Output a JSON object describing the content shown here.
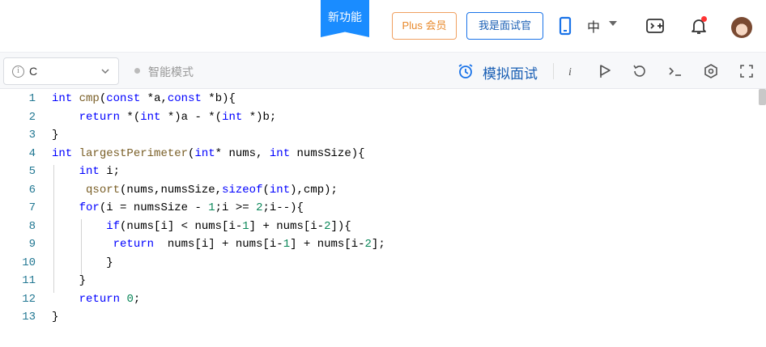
{
  "nav": {
    "new_feature": "新功能",
    "plus": "Plus 会员",
    "interviewer": "我是面试官",
    "language": "中"
  },
  "toolbar": {
    "language_value": "C",
    "smart_mode": "智能模式",
    "mock_interview": "模拟面试",
    "info_glyph": "i"
  },
  "editor": {
    "line_numbers": [
      "1",
      "2",
      "3",
      "4",
      "5",
      "6",
      "7",
      "8",
      "9",
      "10",
      "11",
      "12",
      "13"
    ]
  },
  "colors": {
    "accent": "#1a8cff",
    "plus": "#e8892b",
    "keyword": "#0000ff",
    "function": "#795e26",
    "number": "#098658",
    "line_number": "#237893"
  }
}
